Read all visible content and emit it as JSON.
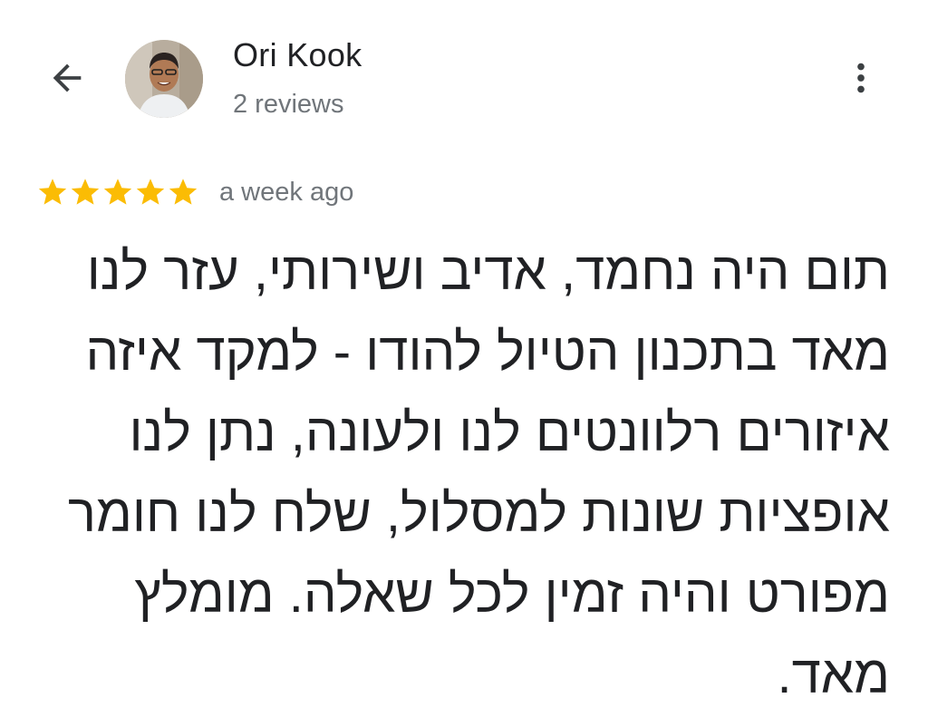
{
  "reviewer": {
    "name": "Ori Kook",
    "reviews_count": "2 reviews"
  },
  "review": {
    "rating": 5,
    "rating_max": 5,
    "time_ago": "a week ago",
    "text": "תום היה נחמד, אדיב ושירותי, עזר לנו מאד בתכנון הטיול להודו - למקד איזה איזורים רלוונטים לנו ולעונה, נתן לנו אופציות שונות למסלול, שלח לנו חומר מפורט והיה זמין לכל שאלה. מומלץ מאד."
  },
  "icons": {
    "back": "arrow-back-icon",
    "more": "more-vert-icon",
    "star": "star-icon"
  },
  "colors": {
    "star": "#fbbc04",
    "primary_text": "#202124",
    "secondary_text": "#70757a",
    "background": "#ffffff"
  }
}
